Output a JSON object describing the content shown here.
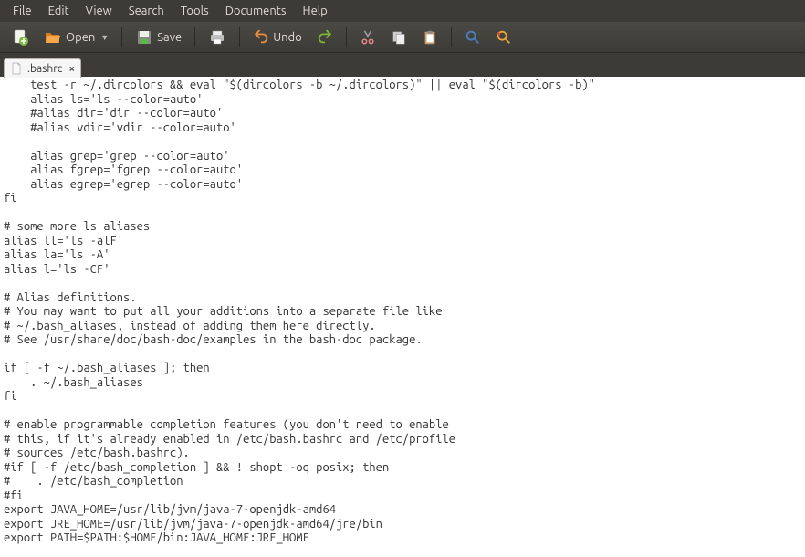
{
  "menubar": {
    "items": [
      "File",
      "Edit",
      "View",
      "Search",
      "Tools",
      "Documents",
      "Help"
    ]
  },
  "toolbar": {
    "open": "Open",
    "save": "Save",
    "undo": "Undo"
  },
  "tab": {
    "filename": ".bashrc"
  },
  "editor": {
    "content": "    test -r ~/.dircolors && eval \"$(dircolors -b ~/.dircolors)\" || eval \"$(dircolors -b)\"\n    alias ls='ls --color=auto'\n    #alias dir='dir --color=auto'\n    #alias vdir='vdir --color=auto'\n\n    alias grep='grep --color=auto'\n    alias fgrep='fgrep --color=auto'\n    alias egrep='egrep --color=auto'\nfi\n\n# some more ls aliases\nalias ll='ls -alF'\nalias la='ls -A'\nalias l='ls -CF'\n\n# Alias definitions.\n# You may want to put all your additions into a separate file like\n# ~/.bash_aliases, instead of adding them here directly.\n# See /usr/share/doc/bash-doc/examples in the bash-doc package.\n\nif [ -f ~/.bash_aliases ]; then\n    . ~/.bash_aliases\nfi\n\n# enable programmable completion features (you don't need to enable\n# this, if it's already enabled in /etc/bash.bashrc and /etc/profile\n# sources /etc/bash.bashrc).\n#if [ -f /etc/bash_completion ] && ! shopt -oq posix; then\n#    . /etc/bash_completion\n#fi\nexport JAVA_HOME=/usr/lib/jvm/java-7-openjdk-amd64\nexport JRE_HOME=/usr/lib/jvm/java-7-openjdk-amd64/jre/bin\nexport PATH=$PATH:$HOME/bin:JAVA_HOME:JRE_HOME"
  }
}
